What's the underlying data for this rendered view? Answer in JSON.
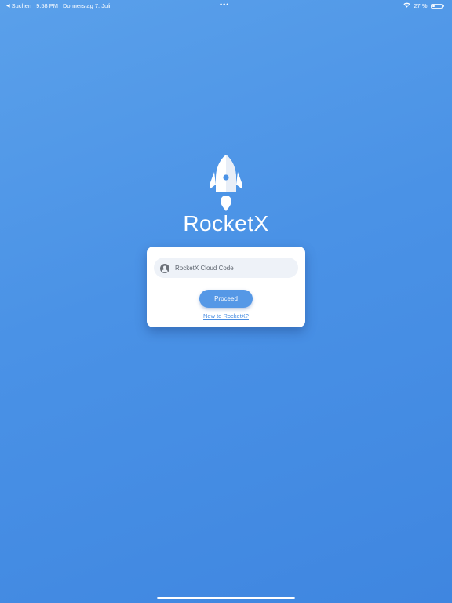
{
  "status_bar": {
    "back_app": "Suchen",
    "time": "9:58 PM",
    "date": "Donnerstag 7. Juli",
    "center_dots": "•••",
    "battery_text": "27 %",
    "battery_level": 0.27
  },
  "app": {
    "title": "RocketX",
    "icon": "rocket-icon"
  },
  "login": {
    "input_placeholder": "RocketX Cloud Code",
    "input_value": "",
    "input_icon": "user-circle-icon",
    "proceed_label": "Proceed",
    "signup_link": "New to RocketX?"
  },
  "colors": {
    "background_top": "#5aa0ea",
    "background_bottom": "#3f86e0",
    "accent": "#5598e6",
    "link": "#4a8ee2"
  }
}
